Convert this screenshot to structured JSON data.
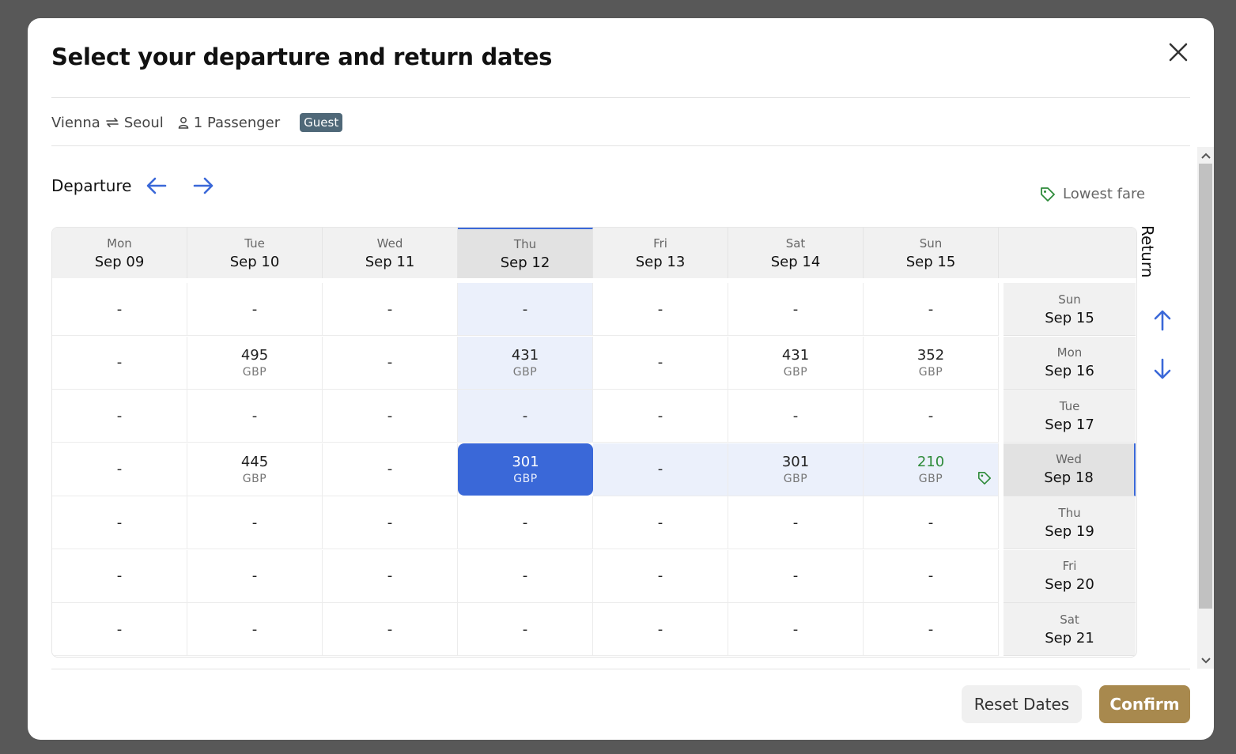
{
  "dialog": {
    "title": "Select your departure and return dates"
  },
  "trip": {
    "origin": "Vienna",
    "destination": "Seoul",
    "passengers": "1 Passenger",
    "badge": "Guest"
  },
  "labels": {
    "departure": "Departure",
    "return": "Return",
    "lowest_fare": "Lowest fare"
  },
  "departure_days": [
    {
      "weekday": "Mon",
      "date": "Sep 09"
    },
    {
      "weekday": "Tue",
      "date": "Sep 10"
    },
    {
      "weekday": "Wed",
      "date": "Sep 11"
    },
    {
      "weekday": "Thu",
      "date": "Sep 12"
    },
    {
      "weekday": "Fri",
      "date": "Sep 13"
    },
    {
      "weekday": "Sat",
      "date": "Sep 14"
    },
    {
      "weekday": "Sun",
      "date": "Sep 15"
    }
  ],
  "return_days": [
    {
      "weekday": "Sun",
      "date": "Sep 15"
    },
    {
      "weekday": "Mon",
      "date": "Sep 16"
    },
    {
      "weekday": "Tue",
      "date": "Sep 17"
    },
    {
      "weekday": "Wed",
      "date": "Sep 18"
    },
    {
      "weekday": "Thu",
      "date": "Sep 19"
    },
    {
      "weekday": "Fri",
      "date": "Sep 20"
    },
    {
      "weekday": "Sat",
      "date": "Sep 21"
    }
  ],
  "currency": "GBP",
  "empty_symbol": "-",
  "fares": [
    [
      "-",
      "-",
      "-",
      "-",
      "-",
      "-",
      "-"
    ],
    [
      "-",
      "495",
      "-",
      "431",
      "-",
      "431",
      "352"
    ],
    [
      "-",
      "-",
      "-",
      "-",
      "-",
      "-",
      "-"
    ],
    [
      "-",
      "445",
      "-",
      "301",
      "-",
      "301",
      "210"
    ],
    [
      "-",
      "-",
      "-",
      "-",
      "-",
      "-",
      "-"
    ],
    [
      "-",
      "-",
      "-",
      "-",
      "-",
      "-",
      "-"
    ],
    [
      "-",
      "-",
      "-",
      "-",
      "-",
      "-",
      "-"
    ]
  ],
  "selected": {
    "departure_index": 3,
    "return_index": 3
  },
  "lowest_fare_cell": {
    "row": 3,
    "col": 6
  },
  "buttons": {
    "reset": "Reset Dates",
    "confirm": "Confirm"
  },
  "colors": {
    "accent_blue": "#3a68d8",
    "confirm_gold": "#a8894e",
    "lowest_green": "#2e8b3a",
    "badge_bg": "#4f6878"
  },
  "icons": {
    "close": "close-icon",
    "swap": "swap-arrows-icon",
    "passenger": "person-icon",
    "tag": "price-tag-icon"
  }
}
